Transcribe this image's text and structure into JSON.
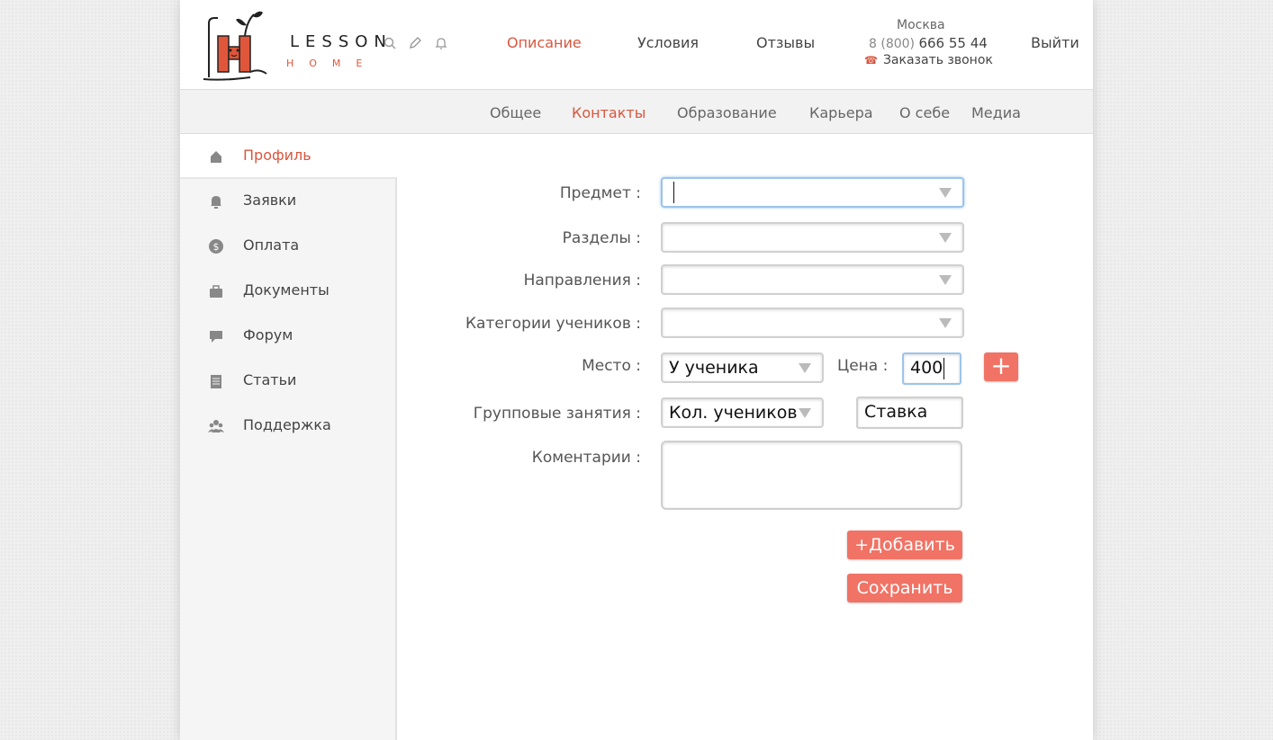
{
  "header": {
    "logo_word": "LESSON",
    "logo_sub": "HOME",
    "nav": [
      "Описание",
      "Условия",
      "Отзывы"
    ],
    "nav_active": "Описание",
    "city": "Москва",
    "phone_prefix": "8 (800)",
    "phone_number": "666 55 44",
    "callback": "Заказать звонок",
    "logout": "Выйти"
  },
  "subnav": {
    "items": [
      "Общее",
      "Контакты",
      "Образование",
      "Карьера",
      "О себе",
      "Медиа"
    ],
    "active": "Контакты"
  },
  "sidebar": {
    "items": [
      {
        "label": "Профиль",
        "icon": "home-icon"
      },
      {
        "label": "Заявки",
        "icon": "bell-icon"
      },
      {
        "label": "Оплата",
        "icon": "dollar-icon"
      },
      {
        "label": "Документы",
        "icon": "briefcase-icon"
      },
      {
        "label": "Форум",
        "icon": "chat-icon"
      },
      {
        "label": "Статьи",
        "icon": "document-icon"
      },
      {
        "label": "Поддержка",
        "icon": "users-icon"
      }
    ],
    "active": "Профиль"
  },
  "form": {
    "subject_label": "Предмет :",
    "sections_label": "Разделы :",
    "directions_label": "Направления :",
    "categories_label": "Категории учеников :",
    "place_label": "Место :",
    "place_value": "У ученика",
    "price_label": "Цена :",
    "price_value": "400",
    "group_label": "Групповые занятия :",
    "group_count_value": "Кол. учеников",
    "rate_value": "Ставка",
    "comments_label": "Коментарии :",
    "add_label": "+Добавить",
    "save_label": "Сохранить",
    "plus_symbol": "+"
  },
  "colors": {
    "accent": "#d9563e",
    "button": "#f07365",
    "focus": "#9cc4ea"
  }
}
